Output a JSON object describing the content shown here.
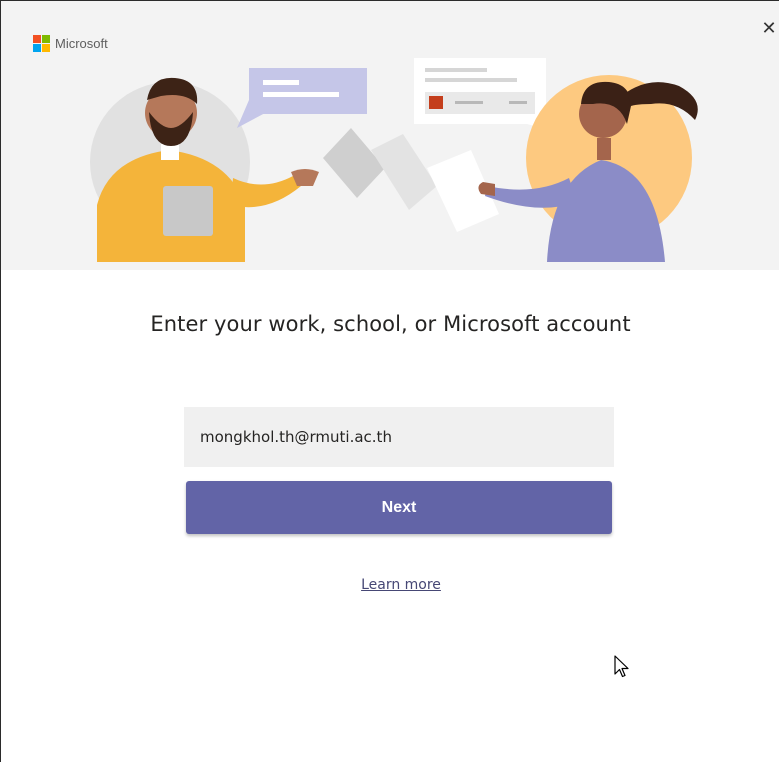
{
  "brand": {
    "name": "Microsoft",
    "logo_colors": [
      "#f25022",
      "#7fba00",
      "#00a4ef",
      "#ffb900"
    ]
  },
  "window": {
    "close_icon": "close-icon",
    "close_glyph": "✕"
  },
  "main": {
    "heading": "Enter your work, school, or Microsoft account",
    "email_value": "mongkhol.th@rmuti.ac.th",
    "next_label": "Next",
    "learn_more_label": "Learn more"
  },
  "colors": {
    "accent": "#6264a7",
    "banner_bg": "#f3f3f3",
    "input_bg": "#f0f0f0",
    "link": "#464775"
  }
}
